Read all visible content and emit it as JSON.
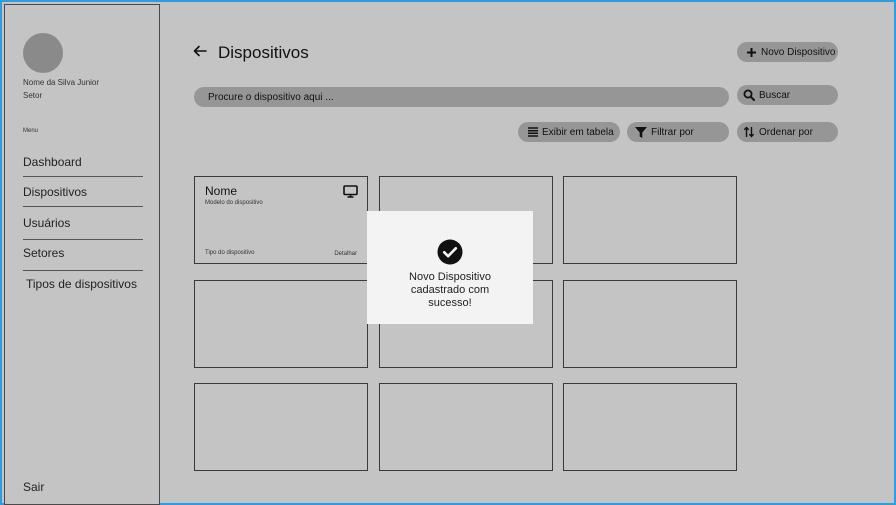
{
  "user": {
    "name": "Nome da Silva Junior",
    "sector": "Setor"
  },
  "sidebar": {
    "menu_label": "Menu",
    "items": [
      {
        "label": "Dashboard"
      },
      {
        "label": "Dispositivos"
      },
      {
        "label": "Usuários"
      },
      {
        "label": "Setores"
      },
      {
        "label": "Tipos de dispositivos"
      }
    ],
    "logout_label": "Sair"
  },
  "header": {
    "title": "Dispositivos",
    "new_button_label": "Novo Dispositivo"
  },
  "search": {
    "placeholder": "Procure o dispositivo aqui ...",
    "button_label": "Buscar"
  },
  "toolbar": {
    "table_view_label": "Exibir em tabela",
    "filter_label": "Filtrar por",
    "sort_label": "Ordenar por"
  },
  "cards": [
    {
      "title": "Nome",
      "model": "Modelo do dispositivo",
      "type": "Tipo do dispositivo",
      "detail_label": "Detalhar",
      "icon": "monitor-icon"
    }
  ],
  "toast": {
    "icon": "check-circle-icon",
    "message": "Novo Dispositivo cadastrado com sucesso!"
  },
  "colors": {
    "background": "#c4c4c4",
    "button_fill": "#969696",
    "toast_fill": "#f3f3f3",
    "frame_border": "#2f9be0"
  }
}
